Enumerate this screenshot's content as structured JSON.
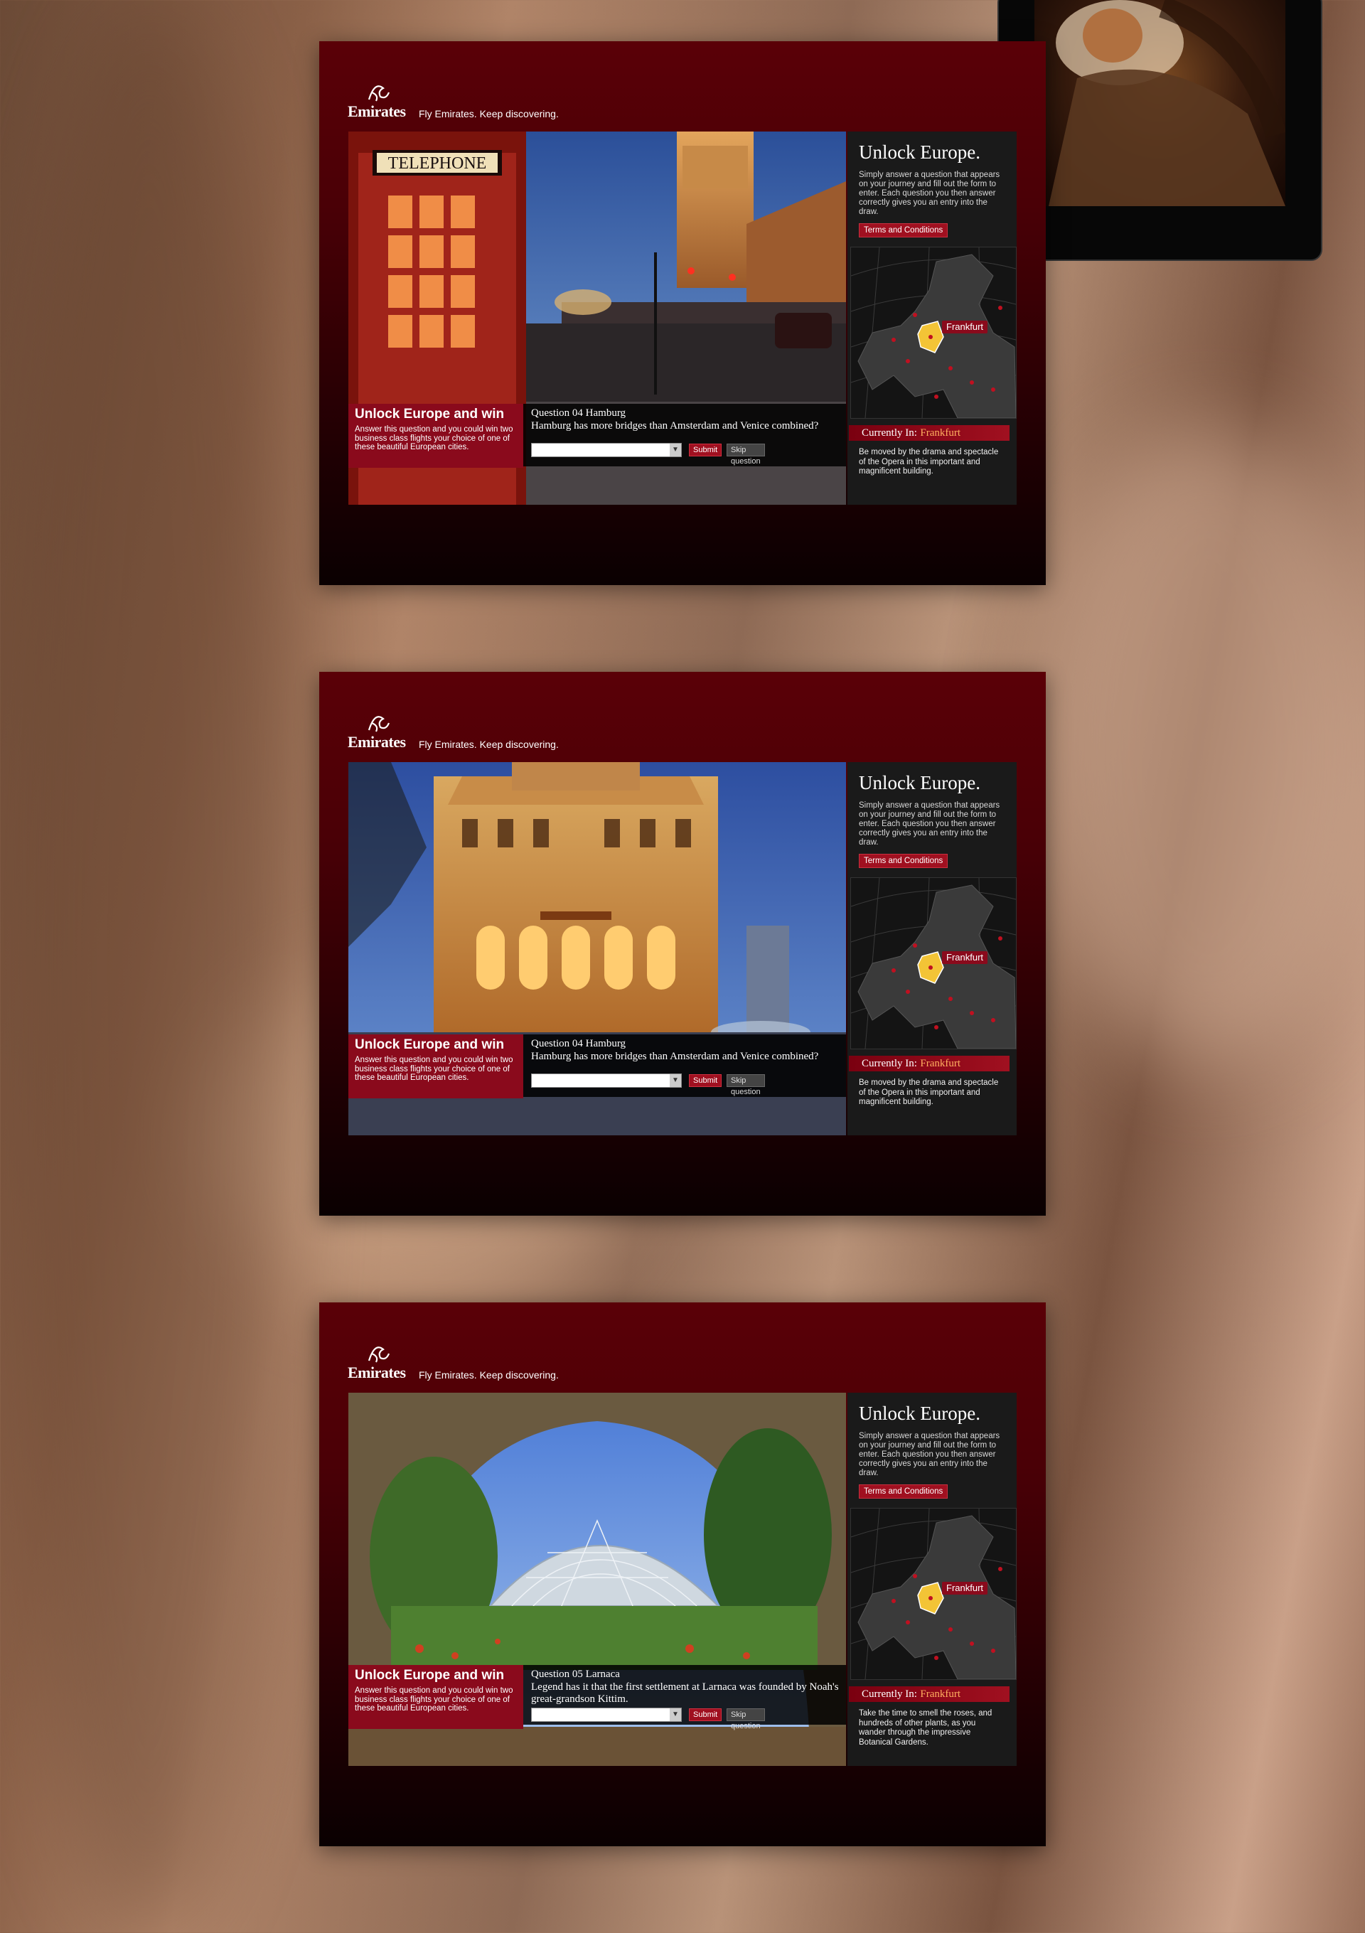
{
  "brand": {
    "name": "Emirates",
    "tagline": "Fly Emirates. Keep discovering."
  },
  "colors": {
    "brand_red": "#a01020",
    "panel_dark": "#4a0006",
    "highlight": "#ffb060"
  },
  "screens": [
    {
      "scene": "london-phone-booth",
      "promo": {
        "title": "Unlock Europe and win",
        "text": "Answer this question and you could win two business class flights your choice of one of these beautiful European cities."
      },
      "question": {
        "label": "Question 04 Hamburg",
        "text": "Hamburg has more bridges than Amsterdam and Venice combined?",
        "submit": "Submit",
        "skip": "Skip question"
      },
      "sidebar": {
        "title": "Unlock Europe.",
        "desc": "Simply answer a question that appears on your journey and fill out the form to enter. Each question you then answer correctly gives you an entry into the draw.",
        "terms": "Terms and Conditions",
        "map_pin": "Frankfurt",
        "current_label": "Currently In:",
        "current_city": "Frankfurt",
        "current_desc": "Be moved by the drama and spectacle of the Opera in this important and magnificent building."
      },
      "phone_sign": "TELEPHONE"
    },
    {
      "scene": "frankfurt-opera",
      "promo": {
        "title": "Unlock Europe and win",
        "text": "Answer this question and you could win two business class flights your choice of one of these beautiful European cities."
      },
      "question": {
        "label": "Question 04 Hamburg",
        "text": "Hamburg has more bridges than Amsterdam and Venice combined?",
        "submit": "Submit",
        "skip": "Skip question"
      },
      "sidebar": {
        "title": "Unlock Europe.",
        "desc": "Simply answer a question that appears on your journey and fill out the form to enter. Each question you then answer correctly gives you an entry into the draw.",
        "terms": "Terms and Conditions",
        "map_pin": "Frankfurt",
        "current_label": "Currently In:",
        "current_city": "Frankfurt",
        "current_desc": "Be moved by the drama and spectacle of the Opera in this important and magnificent building."
      }
    },
    {
      "scene": "botanical-dome",
      "promo": {
        "title": "Unlock Europe and win",
        "text": "Answer this question and you could win two business class flights your choice of one of these beautiful European cities."
      },
      "question": {
        "label": "Question 05 Larnaca",
        "text": "Legend has it that the first settlement at Larnaca was founded by Noah's great-grandson Kittim.",
        "submit": "Submit",
        "skip": "Skip question"
      },
      "sidebar": {
        "title": "Unlock Europe.",
        "desc": "Simply answer a question that appears on your journey and fill out the form to enter. Each question you then answer correctly gives you an entry into the draw.",
        "terms": "Terms and Conditions",
        "map_pin": "Frankfurt",
        "current_label": "Currently In:",
        "current_city": "Frankfurt",
        "current_desc": "Take the time to smell the roses, and hundreds of other plants, as you wander through the impressive Botanical Gardens."
      }
    }
  ]
}
